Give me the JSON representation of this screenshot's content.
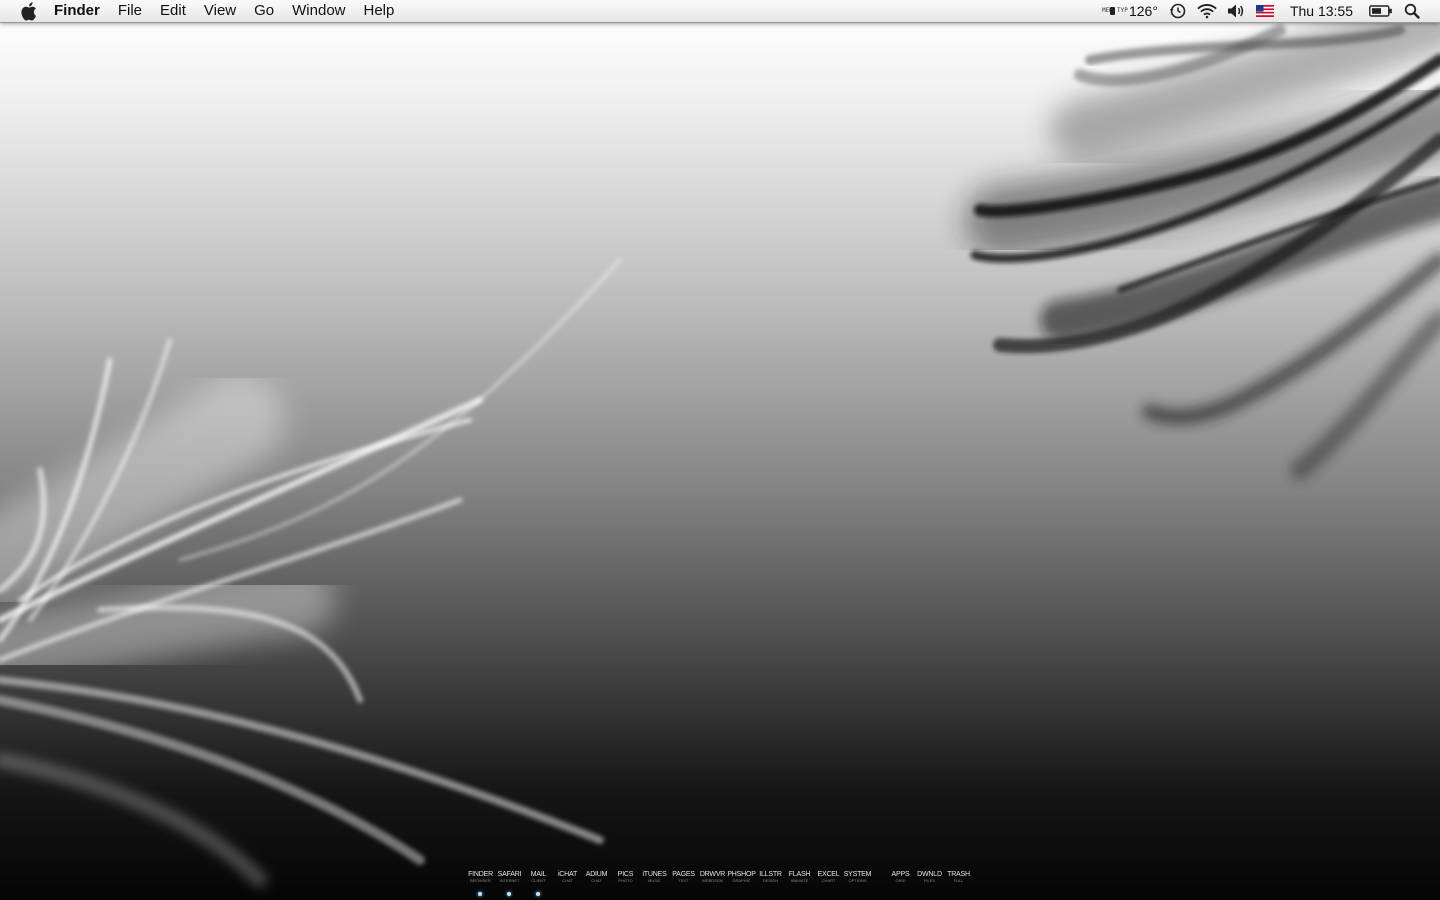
{
  "menubar": {
    "app_name": "Finder",
    "menus": [
      "File",
      "Edit",
      "View",
      "Go",
      "Window",
      "Help"
    ],
    "status": {
      "memory_labels": [
        "MEM",
        "TYP"
      ],
      "temperature": "126°",
      "icons": [
        "time-machine-icon",
        "wifi-icon",
        "volume-icon",
        "us-flag-icon",
        "battery-icon",
        "spotlight-icon"
      ],
      "clock": "Thu 13:55"
    }
  },
  "dock": {
    "items": [
      {
        "label": "FINDER",
        "sub": "BROWSER",
        "running": true
      },
      {
        "label": "SAFARI",
        "sub": "INTERNET",
        "running": true
      },
      {
        "label": "MAIL",
        "sub": "CLIENT",
        "running": true
      },
      {
        "label": "iCHAT",
        "sub": "CHAT",
        "running": false
      },
      {
        "label": "ADIUM",
        "sub": "CHAT",
        "running": false
      },
      {
        "label": "PICS",
        "sub": "PHOTO",
        "running": false
      },
      {
        "label": "iTUNES",
        "sub": "MUSIC",
        "running": false
      },
      {
        "label": "PAGES",
        "sub": "TEXT",
        "running": false
      },
      {
        "label": "DRWVR",
        "sub": "WEBDSGN",
        "running": false
      },
      {
        "label": "PHSHOP",
        "sub": "GRAPHIC",
        "running": false
      },
      {
        "label": "ILLSTR",
        "sub": "DESIGN",
        "running": false
      },
      {
        "label": "FLASH",
        "sub": "ANIMATE",
        "running": false
      },
      {
        "label": "EXCEL",
        "sub": "CHART",
        "running": false
      },
      {
        "label": "SYSTEM",
        "sub": "OPTIONS",
        "running": false
      },
      {
        "label": "APPS",
        "sub": "GRID",
        "running": false
      },
      {
        "label": "DWNLD",
        "sub": "FILES",
        "running": false
      },
      {
        "label": "TRASH",
        "sub": "FULL",
        "running": false
      }
    ]
  },
  "colors": {
    "menubar_bg": "#ececec",
    "dock_label": "#e6e6e6",
    "running_indicator": "#bfe4ff"
  }
}
